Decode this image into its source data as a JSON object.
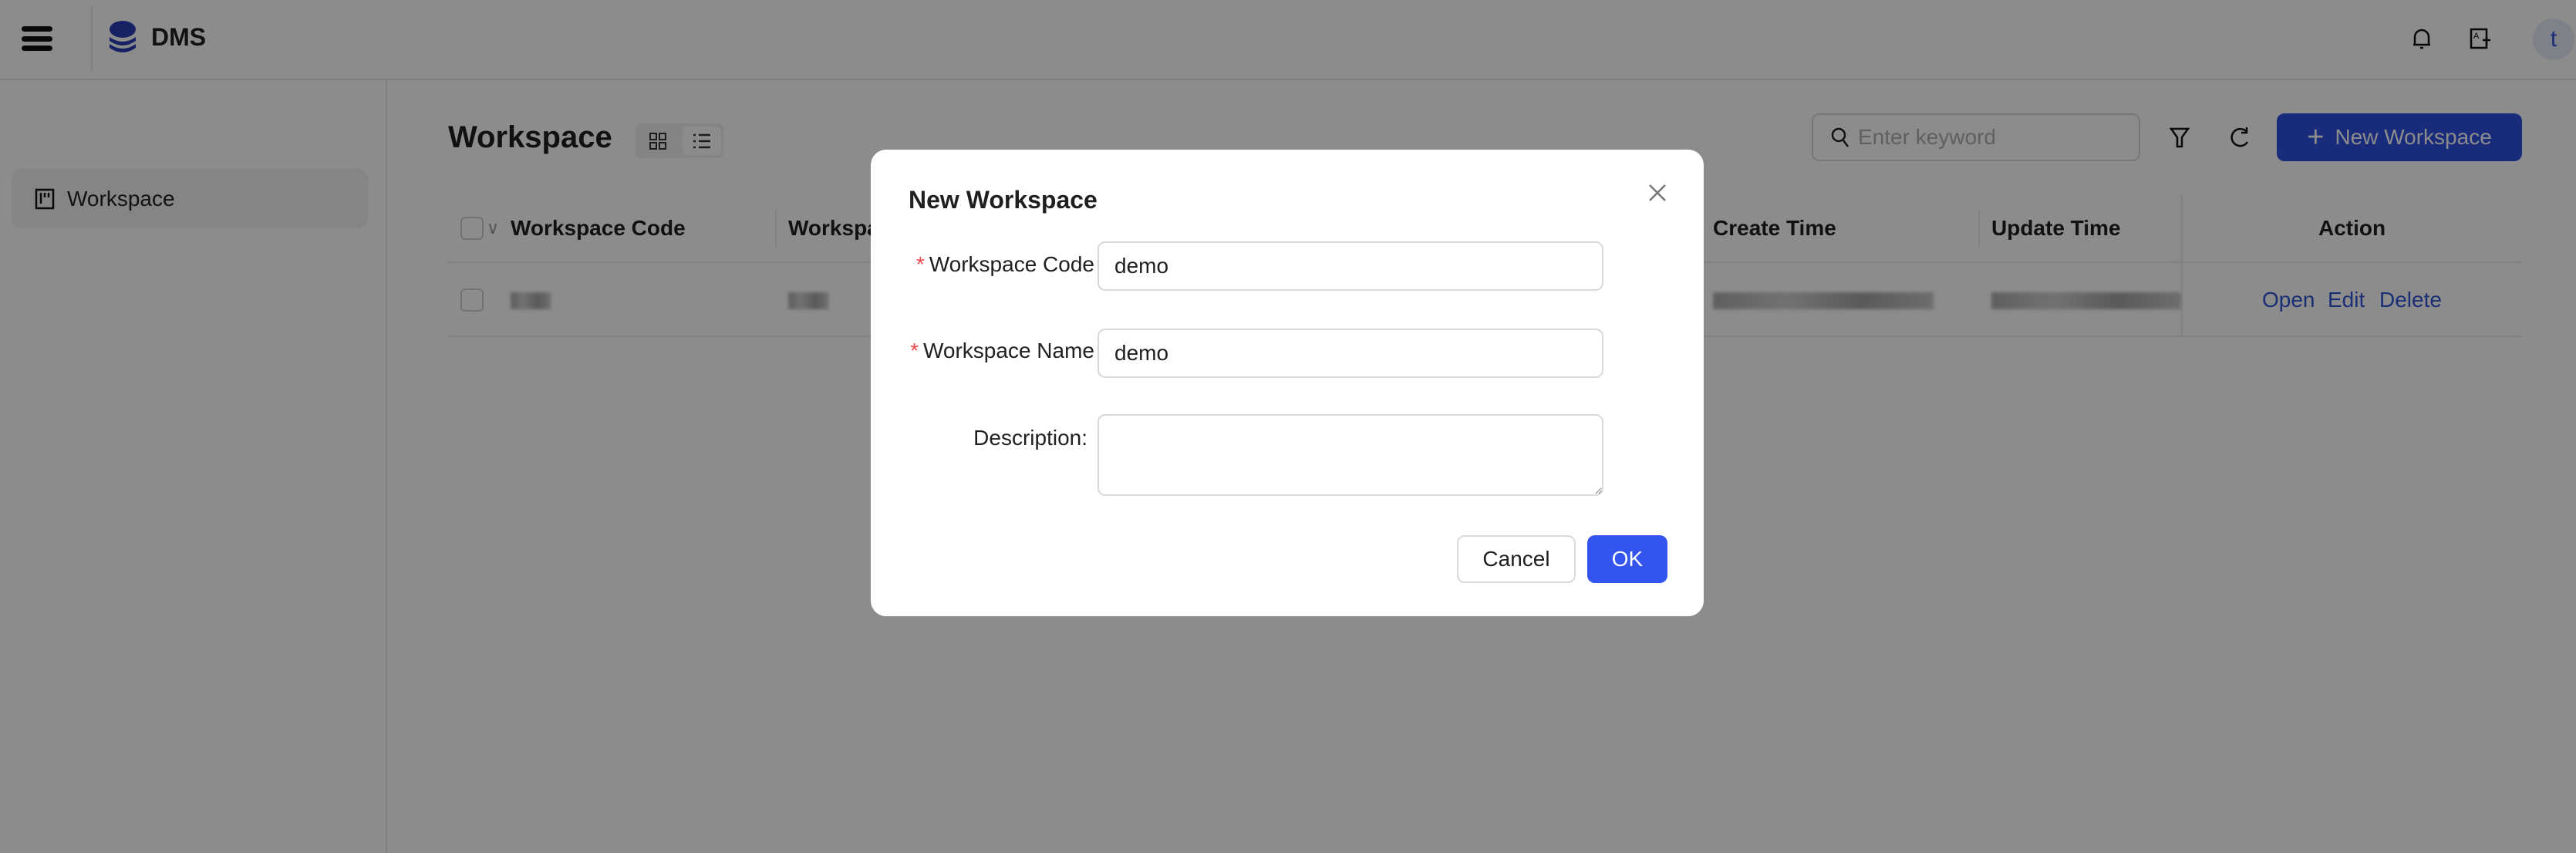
{
  "header": {
    "app_name": "DMS",
    "avatar_initial": "t",
    "icons": [
      "menu-icon",
      "database-logo-icon",
      "bell-icon",
      "language-icon"
    ]
  },
  "sidebar": {
    "items": [
      {
        "label": "Workspace",
        "icon": "workspace-icon",
        "active": true
      }
    ]
  },
  "main": {
    "title": "Workspace",
    "view_toggle": {
      "options": [
        "grid",
        "list"
      ],
      "selected": "list"
    },
    "search": {
      "placeholder": "Enter keyword",
      "value": ""
    },
    "new_button": "New Workspace",
    "table": {
      "columns": [
        "Workspace Code",
        "Workspace Name",
        "Create Time",
        "Update Time",
        "Action"
      ],
      "rows": [
        {
          "actions": [
            "Open",
            "Edit",
            "Delete"
          ]
        }
      ]
    }
  },
  "modal": {
    "title": "New Workspace",
    "fields": [
      {
        "label": "Workspace Code",
        "required": true,
        "value": "demo"
      },
      {
        "label": "Workspace Name",
        "required": true,
        "value": "demo"
      },
      {
        "label": "Description:",
        "required": false,
        "value": ""
      }
    ],
    "cancel": "Cancel",
    "ok": "OK"
  },
  "colors": {
    "primary": "#3355ee",
    "link": "#2f55d4",
    "required": "#f04848",
    "overlay": "rgba(0,0,0,0.45)"
  }
}
